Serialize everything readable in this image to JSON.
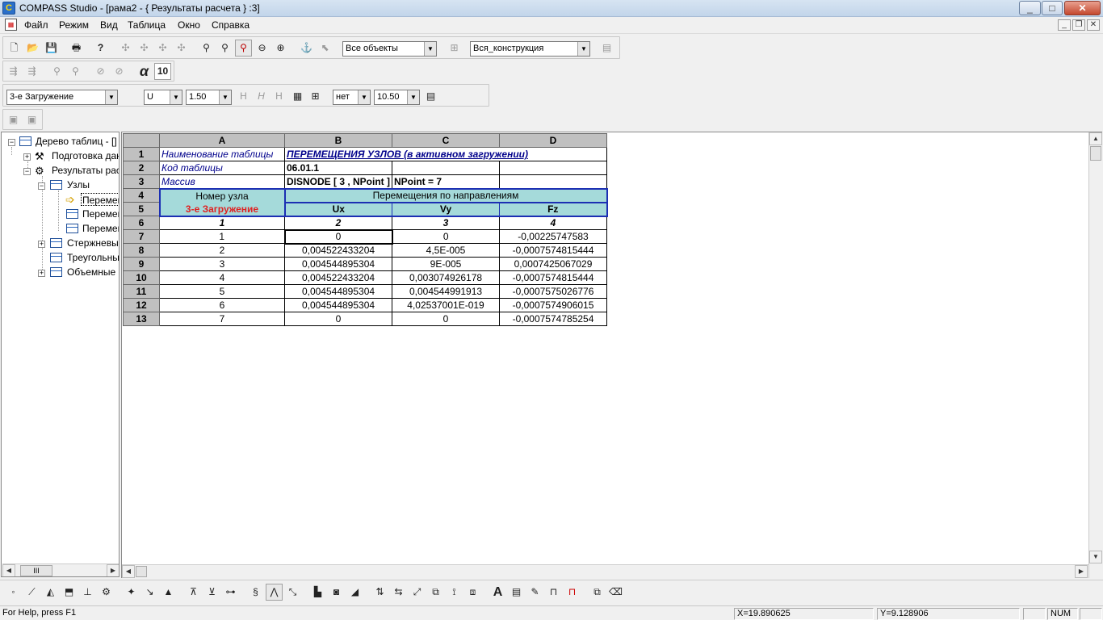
{
  "window": {
    "title": "COMPASS  Studio - [рама2 - { Результаты расчета } :3]",
    "controls": [
      "_",
      "□",
      "✕"
    ]
  },
  "menu": [
    "Файл",
    "Режим",
    "Вид",
    "Таблица",
    "Окно",
    "Справка"
  ],
  "toolbar1": {
    "objects_combo": "Все объекты",
    "construction_combo": "Вся_конструкция"
  },
  "toolbar2": {
    "alpha": "α",
    "font_size_box": "10"
  },
  "toolbar3": {
    "load_combo": "3-е Загружение",
    "u_combo": "U",
    "scale_combo": "1.50",
    "net_combo": "нет",
    "value_combo": "10.50"
  },
  "tree": {
    "nodes": [
      {
        "label": "Дерево таблиц - []"
      },
      {
        "label": "Подготовка данных"
      },
      {
        "label": "Результаты расчета"
      },
      {
        "label": "Узлы"
      },
      {
        "label": "Перемещения"
      },
      {
        "label": "Перемещения"
      },
      {
        "label": "Перемещения"
      },
      {
        "label": "Стержневые"
      },
      {
        "label": "Треугольные"
      },
      {
        "label": "Объемные"
      }
    ],
    "scroll_label": "III"
  },
  "sheet": {
    "columns": [
      "A",
      "B",
      "C",
      "D"
    ],
    "row_numbers": [
      "1",
      "2",
      "3",
      "4",
      "5",
      "6",
      "7",
      "8",
      "9",
      "10",
      "11",
      "12",
      "13"
    ],
    "r1": {
      "a": "Наименование  таблицы",
      "b": "ПЕРЕМЕЩЕНИЯ УЗЛОВ (в активном загружении)"
    },
    "r2": {
      "a": "Код таблицы",
      "b": "06.01.1"
    },
    "r3": {
      "a": "Массив",
      "b": "DISNODE [ 3 , NPoint ]",
      "c": "NPoint = 7"
    },
    "r4": {
      "a": "Номер узла",
      "b": "Перемещения по направлениям"
    },
    "r5": {
      "a": "3-е Загружение",
      "b": "Ux",
      "c": "Vy",
      "d": "Fz"
    },
    "r6": {
      "a": "1",
      "b": "2",
      "c": "3",
      "d": "4"
    },
    "data": [
      {
        "a": "1",
        "b": "0",
        "c": "0",
        "d": "-0,00225747583"
      },
      {
        "a": "2",
        "b": "0,004522433204",
        "c": "4,5E-005",
        "d": "-0,0007574815444"
      },
      {
        "a": "3",
        "b": "0,004544895304",
        "c": "9E-005",
        "d": "0,0007425067029"
      },
      {
        "a": "4",
        "b": "0,004522433204",
        "c": "0,003074926178",
        "d": "-0,0007574815444"
      },
      {
        "a": "5",
        "b": "0,004544895304",
        "c": "0,004544991913",
        "d": "-0,0007575026776"
      },
      {
        "a": "6",
        "b": "0,004544895304",
        "c": "4,02537001E-019",
        "d": "-0,0007574906015"
      },
      {
        "a": "7",
        "b": "0",
        "c": "0",
        "d": "-0,0007574785254"
      }
    ]
  },
  "status": {
    "help": "For Help, press F1",
    "x": "X=19.890625",
    "y": "Y=9.128906",
    "num": "NUM"
  }
}
